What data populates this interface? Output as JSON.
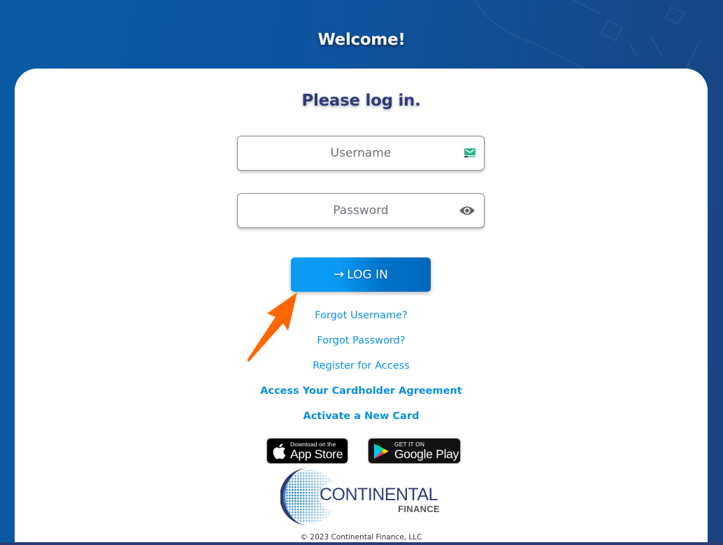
{
  "header": {
    "title": "Welcome!"
  },
  "login_card": {
    "title": "Please log in.",
    "username": {
      "placeholder": "Username",
      "value": "",
      "icon": "email-autofill-icon"
    },
    "password": {
      "placeholder": "Password",
      "value": "",
      "icon": "eye-icon"
    },
    "login_button": {
      "label": "LOG IN",
      "icon": "arrow-right-icon",
      "icon_glyph": "→"
    },
    "links": [
      {
        "label": "Forgot Username?",
        "bold": false
      },
      {
        "label": "Forgot Password?",
        "bold": false
      },
      {
        "label": "Register for Access",
        "bold": false
      },
      {
        "label": "Access Your Cardholder Agreement",
        "bold": true
      },
      {
        "label": "Activate a New Card",
        "bold": true
      }
    ],
    "app_store_badge": {
      "small": "Download on the",
      "big": "App Store",
      "icon": "apple-icon"
    },
    "google_play_badge": {
      "small": "GET IT ON",
      "big": "Google Play",
      "icon": "google-play-icon"
    },
    "logo": {
      "main": "CONTINENTAL",
      "sub": "FINANCE"
    },
    "copyright": "© 2023 Continental Finance, LLC"
  },
  "annotation": {
    "icon": "orange-pointer-arrow-icon",
    "color": "#ff6600"
  },
  "colors": {
    "background_blue": "#0e539d",
    "title_navy": "#2e3b76",
    "link_blue": "#0a8fe0",
    "button_blue": "#0a9cf5",
    "annotation_orange": "#ff6600"
  }
}
